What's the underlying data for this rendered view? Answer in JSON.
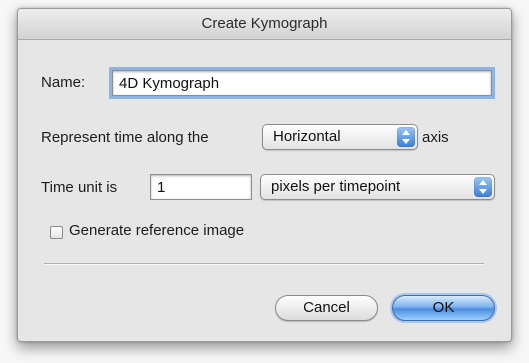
{
  "window": {
    "title": "Create Kymograph"
  },
  "form": {
    "name_label": "Name:",
    "name_value": "4D Kymograph",
    "represent_prefix": "Represent time along the",
    "represent_selected": "Horizontal",
    "represent_suffix": "axis",
    "time_unit_label": "Time unit is",
    "time_unit_value": "1",
    "time_unit_selected": "pixels per timepoint",
    "reference_label": "Generate reference image",
    "reference_checked": false
  },
  "buttons": {
    "cancel_label": "Cancel",
    "ok_label": "OK"
  },
  "icons": {
    "popup_arrows": "up-down-arrows-icon",
    "checkbox": "checkbox-icon"
  },
  "colors": {
    "accent": "#3b7fd9",
    "focus_ring": "#8fb4e3",
    "dialog_bg": "#e6e6e6"
  }
}
